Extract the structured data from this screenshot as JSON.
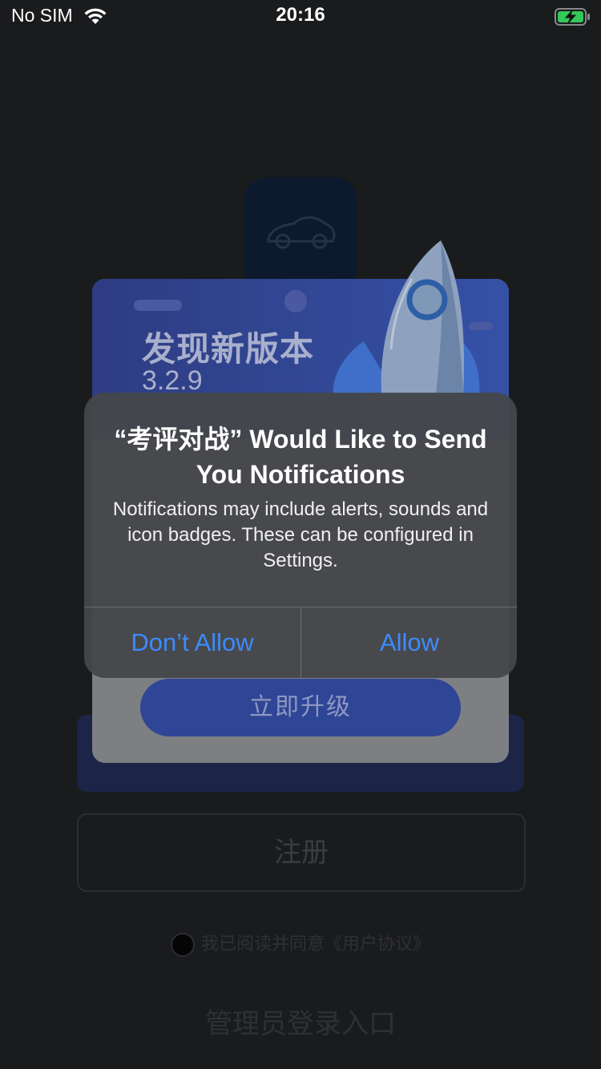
{
  "status_bar": {
    "carrier": "No SIM",
    "time": "20:16"
  },
  "background": {
    "register_label": "注册",
    "agreement_text": "我已阅读并同意《用户协议》",
    "admin_entry_label": "管理员登录入口"
  },
  "update_card": {
    "title": "发现新版本",
    "version": "3.2.9",
    "upgrade_label": "立即升级"
  },
  "alert": {
    "title": "“考评对战” Would Like to Send You Notifications",
    "message": "Notifications may include alerts, sounds and icon badges. These can be configured in Settings.",
    "deny_label": "Don’t Allow",
    "allow_label": "Allow"
  },
  "colors": {
    "alert_button": "#3b8cff",
    "update_header": "#3551a6",
    "battery_charge": "#34c759"
  }
}
